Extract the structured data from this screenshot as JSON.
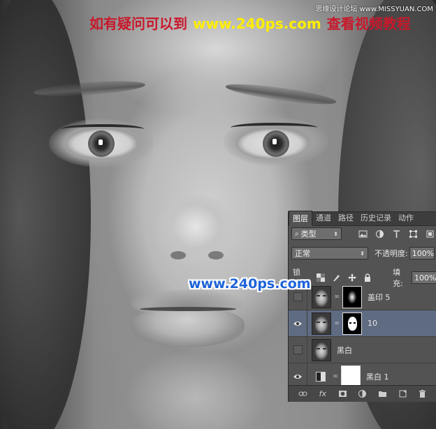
{
  "banner": {
    "left_text": "如有疑问可以到",
    "site": "www.240ps.com",
    "right_text": "查看视频教程"
  },
  "source_mark": "思缘设计论坛 www.MISSYUAN.COM",
  "watermark": "www.240ps.com",
  "layers_panel": {
    "tabs": [
      {
        "label": "图层",
        "active": true
      },
      {
        "label": "通道",
        "active": false
      },
      {
        "label": "路径",
        "active": false
      },
      {
        "label": "历史记录",
        "active": false
      },
      {
        "label": "动作",
        "active": false
      }
    ],
    "filter_kind": "类型",
    "blend_mode": "正常",
    "opacity_label": "不透明度:",
    "opacity_value": "100%",
    "lock_label": "锁定:",
    "fill_label": "填充:",
    "fill_value": "100%",
    "layers": [
      {
        "name": "盖印 5",
        "visible": false,
        "selected": false
      },
      {
        "name": "10",
        "visible": true,
        "selected": true
      },
      {
        "name": "黑白",
        "visible": false,
        "selected": false
      },
      {
        "name": "黑白 1",
        "visible": true,
        "selected": false
      }
    ],
    "footer_icons": [
      "link-icon",
      "fx-icon",
      "add-mask-icon",
      "adjustment-icon",
      "folder-icon",
      "new-layer-icon",
      "trash-icon"
    ],
    "selected_color": "#5f6b81"
  },
  "colors": {
    "banner_red": "#c9182b",
    "banner_yellow": "#ffee00",
    "watermark_blue": "#1f64d8"
  }
}
